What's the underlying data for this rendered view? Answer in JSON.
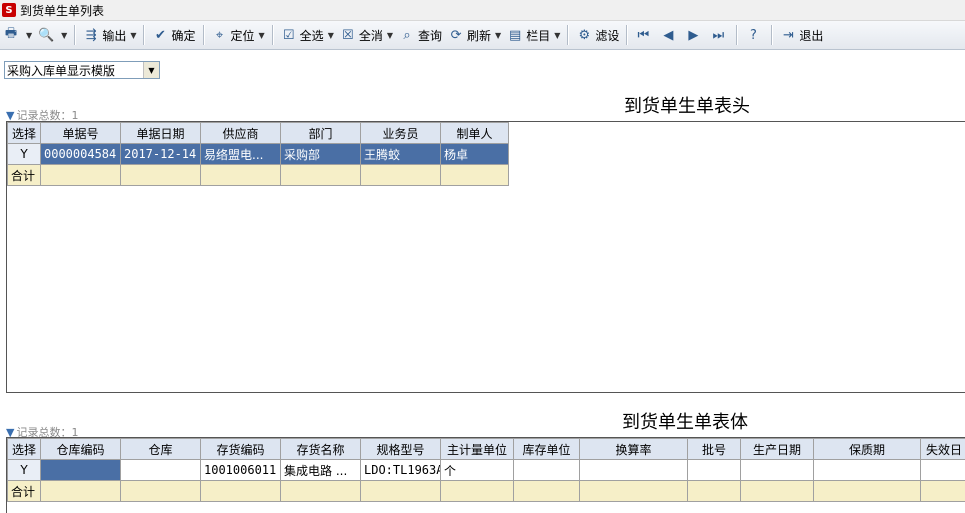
{
  "window": {
    "title": "到货单生单列表",
    "logo_text": "S"
  },
  "toolbar": {
    "items": [
      {
        "label": "",
        "icon": "print-icon",
        "glyph": "🖶",
        "arrow": true
      },
      {
        "label": "",
        "icon": "preview-icon",
        "glyph": "🔍",
        "arrow": true
      },
      {
        "label": "输出",
        "icon": "export-icon",
        "glyph": "⇶",
        "arrow": true
      },
      {
        "label": "确定",
        "icon": "confirm-icon",
        "glyph": "✔"
      },
      {
        "label": "定位",
        "icon": "locate-icon",
        "glyph": "⌖",
        "arrow": true
      },
      {
        "label": "全选",
        "icon": "select-all-icon",
        "glyph": "☑",
        "arrow": true
      },
      {
        "label": "全消",
        "icon": "deselect-all-icon",
        "glyph": "☒",
        "arrow": true
      },
      {
        "label": "查询",
        "icon": "query-icon",
        "glyph": "⌕"
      },
      {
        "label": "刷新",
        "icon": "refresh-icon",
        "glyph": "⟳",
        "arrow": true
      },
      {
        "label": "栏目",
        "icon": "columns-icon",
        "glyph": "▤",
        "arrow": true
      },
      {
        "label": "滤设",
        "icon": "filter-settings-icon",
        "glyph": "⚙"
      },
      {
        "label": "",
        "icon": "first-icon",
        "glyph": "⏮"
      },
      {
        "label": "",
        "icon": "prev-icon",
        "glyph": "◀"
      },
      {
        "label": "",
        "icon": "next-icon",
        "glyph": "▶"
      },
      {
        "label": "",
        "icon": "last-icon",
        "glyph": "⏭"
      },
      {
        "label": "",
        "icon": "help-icon",
        "glyph": "?"
      },
      {
        "label": "退出",
        "icon": "exit-icon",
        "glyph": "⇥"
      }
    ]
  },
  "template": {
    "selected": "采购入库单显示模版"
  },
  "header_section": {
    "title": "到货单生单表头",
    "record_label": "记录总数：1",
    "columns": [
      "选择",
      "单据号",
      "单据日期",
      "供应商",
      "部门",
      "业务员",
      "制单人"
    ],
    "rows": [
      [
        "Y",
        "0000004584",
        "2017-12-14",
        "易络盟电...",
        "采购部",
        "王腾蛟",
        "杨卓"
      ]
    ],
    "total_label": "合计"
  },
  "body_section": {
    "title": "到货单生单表体",
    "record_label": "记录总数：1",
    "columns": [
      "选择",
      "仓库编码",
      "仓库",
      "存货编码",
      "存货名称",
      "规格型号",
      "主计量单位",
      "库存单位",
      "换算率",
      "批号",
      "生产日期",
      "保质期",
      "失效日"
    ],
    "rows": [
      [
        "Y",
        "",
        "",
        "1001006011",
        "集成电路 ...",
        "LDO:TL1963A",
        "个",
        "",
        "",
        "",
        "",
        "",
        ""
      ]
    ],
    "total_label": "合计"
  }
}
